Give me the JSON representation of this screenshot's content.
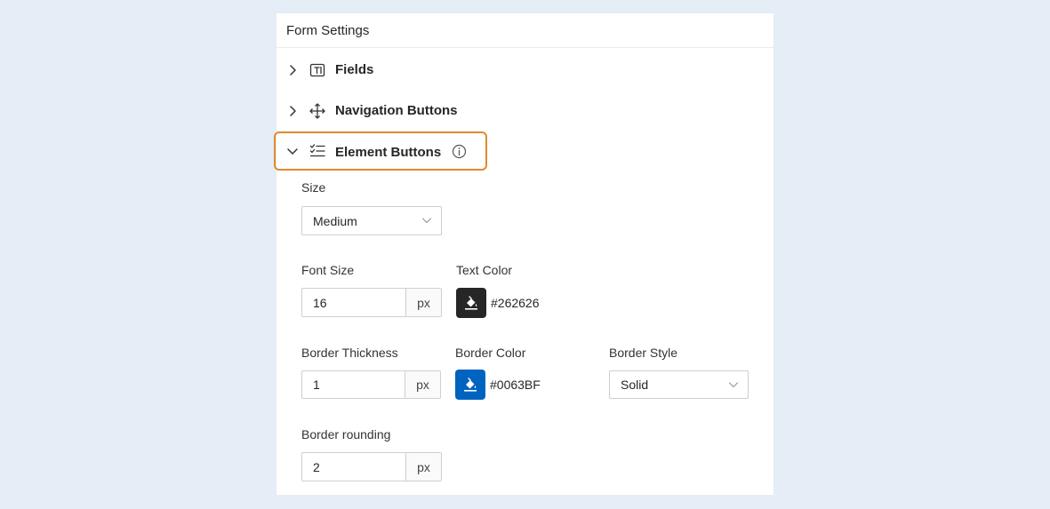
{
  "panel": {
    "title": "Form Settings"
  },
  "sections": {
    "fields": {
      "label": "Fields",
      "icon": "text-field-icon",
      "expanded": false
    },
    "navigation": {
      "label": "Navigation Buttons",
      "icon": "move-arrows-icon",
      "expanded": false
    },
    "element": {
      "label": "Element Buttons",
      "icon": "checklist-icon",
      "expanded": true,
      "info_icon": "info-icon"
    }
  },
  "element_buttons": {
    "size": {
      "label": "Size",
      "value": "Medium"
    },
    "font_size": {
      "label": "Font Size",
      "value": "16",
      "unit": "px"
    },
    "text_color": {
      "label": "Text Color",
      "value": "#262626",
      "swatch": "#262626"
    },
    "border_thickness": {
      "label": "Border Thickness",
      "value": "1",
      "unit": "px"
    },
    "border_color": {
      "label": "Border Color",
      "value": "#0063BF",
      "swatch": "#0063BF"
    },
    "border_style": {
      "label": "Border Style",
      "value": "Solid"
    },
    "border_rounding": {
      "label": "Border rounding",
      "value": "2",
      "unit": "px"
    }
  },
  "colors": {
    "highlight_border": "#e08a2d",
    "background": "#e5edf6",
    "panel": "#ffffff"
  }
}
